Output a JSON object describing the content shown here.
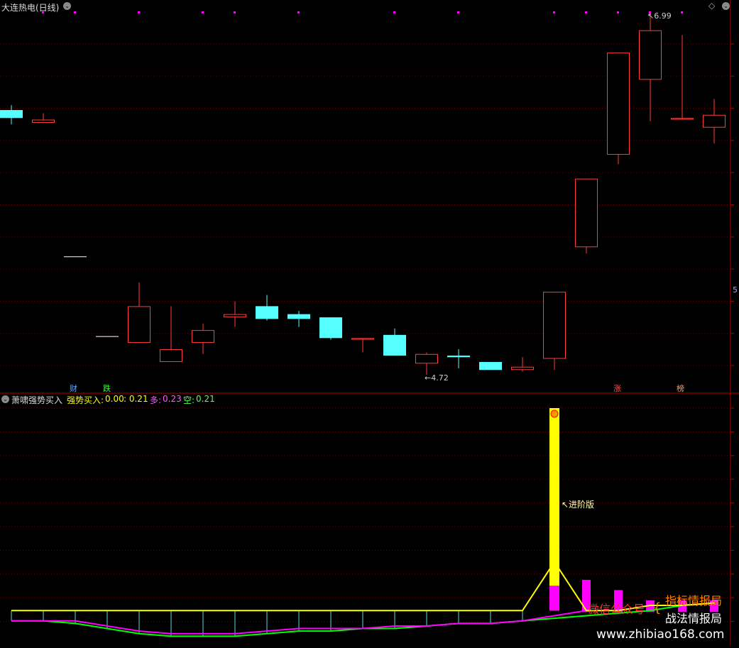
{
  "main_title": "大连热电(日线)",
  "indicator_title": "萧啸强势买入",
  "indicator_values": {
    "label": "强势买入:",
    "v1": "0.00",
    "v2": ": 0.21",
    "duo_label": "多:",
    "duo_value": "0.23",
    "kong_label": "空:",
    "kong_value": "0.21"
  },
  "right_axis_mark": "5",
  "price_labels": {
    "high": "6.99",
    "low": "4.72"
  },
  "event_tags": [
    {
      "text": "财",
      "color": "#66aaff"
    },
    {
      "text": "跌",
      "color": "#33ff33"
    },
    {
      "text": "涨",
      "color": "#ff5555"
    },
    {
      "text": "榜",
      "color": "#ff9966"
    }
  ],
  "annotation": "↖进阶版",
  "watermark": {
    "line1": "微信公众号",
    "line2a": "指标情报局",
    "line2b": "战法情报局",
    "url": "www.zhibiao168.com"
  },
  "colors": {
    "up": "#ff3b3b",
    "down": "#55ffff",
    "grid": "#6b0000",
    "yellow": "#ffff00",
    "magenta": "#ff00ff",
    "green": "#00ff00",
    "separator": "#b00000"
  },
  "chart_data": {
    "type": "candlestick",
    "candles": [
      {
        "open": 6.38,
        "close": 6.33,
        "high": 6.41,
        "low": 6.29,
        "dir": "down"
      },
      {
        "open": 6.3,
        "close": 6.32,
        "high": 6.36,
        "low": 6.3,
        "dir": "up"
      },
      {
        "open": 5.46,
        "close": 5.46,
        "high": 5.46,
        "low": 5.46,
        "dir": "flat"
      },
      {
        "open": 4.96,
        "close": 4.96,
        "high": 4.96,
        "low": 4.96,
        "dir": "flat"
      },
      {
        "open": 4.92,
        "close": 5.15,
        "high": 5.3,
        "low": 4.92,
        "dir": "up"
      },
      {
        "open": 4.8,
        "close": 4.88,
        "high": 5.15,
        "low": 4.8,
        "dir": "up"
      },
      {
        "open": 4.92,
        "close": 5.0,
        "high": 5.04,
        "low": 4.85,
        "dir": "up"
      },
      {
        "open": 5.08,
        "close": 5.1,
        "high": 5.18,
        "low": 5.02,
        "dir": "up"
      },
      {
        "open": 5.15,
        "close": 5.07,
        "high": 5.22,
        "low": 5.06,
        "dir": "down"
      },
      {
        "open": 5.1,
        "close": 5.07,
        "high": 5.12,
        "low": 5.02,
        "dir": "down"
      },
      {
        "open": 5.08,
        "close": 4.95,
        "high": 5.08,
        "low": 4.94,
        "dir": "down"
      },
      {
        "open": 4.94,
        "close": 4.95,
        "high": 4.95,
        "low": 4.86,
        "dir": "up"
      },
      {
        "open": 4.97,
        "close": 4.84,
        "high": 5.01,
        "low": 4.84,
        "dir": "down"
      },
      {
        "open": 4.79,
        "close": 4.85,
        "high": 4.86,
        "low": 4.72,
        "dir": "up"
      },
      {
        "open": 4.84,
        "close": 4.83,
        "high": 4.88,
        "low": 4.76,
        "dir": "down"
      },
      {
        "open": 4.8,
        "close": 4.75,
        "high": 4.8,
        "low": 4.75,
        "dir": "down"
      },
      {
        "open": 4.75,
        "close": 4.77,
        "high": 4.83,
        "low": 4.74,
        "dir": "up"
      },
      {
        "open": 4.82,
        "close": 5.24,
        "high": 5.24,
        "low": 4.75,
        "dir": "up"
      },
      {
        "open": 5.52,
        "close": 5.95,
        "high": 5.95,
        "low": 5.48,
        "dir": "up"
      },
      {
        "open": 6.1,
        "close": 6.74,
        "high": 6.74,
        "low": 6.04,
        "dir": "up"
      },
      {
        "open": 6.57,
        "close": 6.88,
        "high": 6.99,
        "low": 6.31,
        "dir": "up"
      },
      {
        "open": 6.32,
        "close": 6.33,
        "high": 6.85,
        "low": 6.32,
        "dir": "up"
      },
      {
        "open": 6.27,
        "close": 6.35,
        "high": 6.45,
        "low": 6.17,
        "dir": "up"
      }
    ],
    "indicator": {
      "bars": [
        0,
        0,
        0,
        0,
        0,
        0,
        0,
        0,
        0,
        0,
        0,
        0,
        0,
        0,
        0,
        0,
        0,
        1.0,
        0.12,
        0.08,
        0.04,
        0.04,
        0.04
      ],
      "yellow_line": [
        0.21,
        0.21,
        0.21,
        0.21,
        0.21,
        0.21,
        0.21,
        0.21,
        0.21,
        0.21,
        0.21,
        0.21,
        0.21,
        0.21,
        0.21,
        0.21,
        0.21,
        0.4,
        0.21,
        0.21,
        0.23,
        0.23,
        0.24
      ],
      "duo_line": [
        0.17,
        0.17,
        0.17,
        0.15,
        0.13,
        0.12,
        0.12,
        0.12,
        0.13,
        0.14,
        0.14,
        0.14,
        0.15,
        0.15,
        0.16,
        0.16,
        0.17,
        0.19,
        0.21,
        0.21,
        0.23,
        0.23,
        0.24
      ],
      "kong_line": [
        0.17,
        0.17,
        0.16,
        0.14,
        0.12,
        0.11,
        0.11,
        0.11,
        0.12,
        0.13,
        0.13,
        0.14,
        0.14,
        0.15,
        0.16,
        0.16,
        0.17,
        0.18,
        0.19,
        0.2,
        0.21,
        0.23,
        0.24
      ]
    }
  }
}
